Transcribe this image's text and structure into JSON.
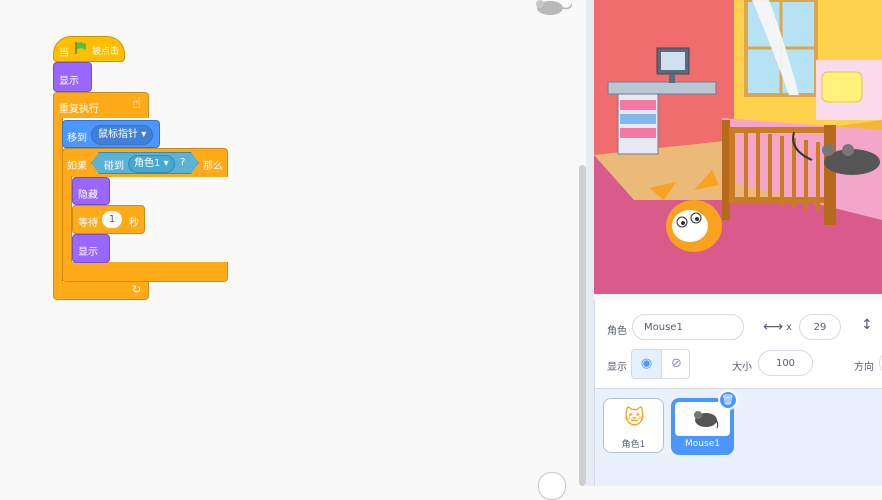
{
  "blocks": {
    "when_flag": {
      "prefix": "当",
      "suffix": "被点击",
      "flag_icon": "green-flag-icon"
    },
    "show1": "显示",
    "forever": "重复执行",
    "goto": {
      "label": "移到",
      "target": "鼠标指针"
    },
    "if": {
      "label": "如果",
      "touching": "碰到",
      "target": "角色1",
      "question": "?",
      "then": "那么"
    },
    "hide": "隐藏",
    "wait": {
      "label": "等待",
      "value": "1",
      "unit": "秒"
    },
    "show2": "显示"
  },
  "sprite_info": {
    "sprite_label": "角色",
    "sprite_name": "Mouse1",
    "x_label": "x",
    "x_value": "29",
    "show_label": "显示",
    "size_label": "大小",
    "size_value": "100",
    "direction_label": "方向"
  },
  "sprites": [
    {
      "name": "角色1",
      "selected": false
    },
    {
      "name": "Mouse1",
      "selected": true
    }
  ],
  "colors": {
    "events": "#ffbf00",
    "looks": "#9966ff",
    "control": "#ffab19",
    "motion": "#4c97ff",
    "sensing": "#5cb1d6",
    "selected": "#4c97ff"
  }
}
